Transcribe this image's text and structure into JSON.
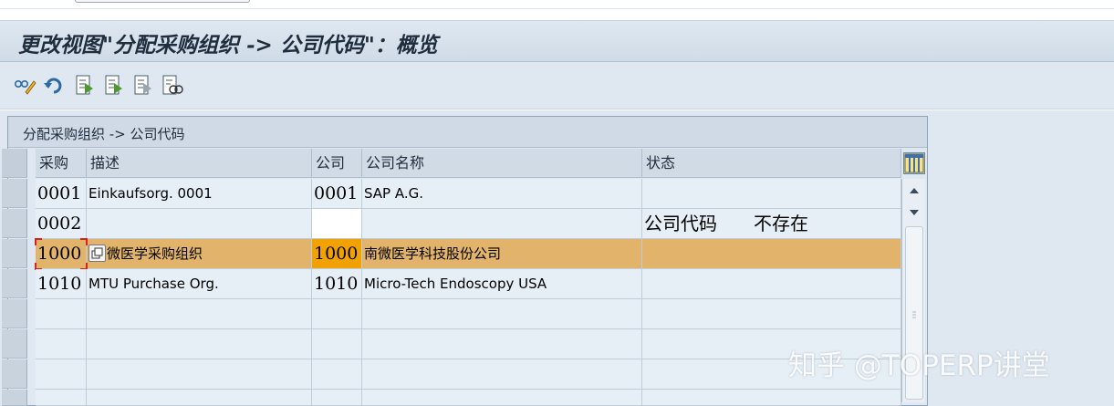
{
  "window": {
    "title": "更改视图\"分配采购组织 -> 公司代码\"：概览"
  },
  "toolbar": {
    "icons": [
      "display-change-icon",
      "undo-icon",
      "new-entries-icon",
      "copy-as-icon",
      "delete-icon",
      "select-all-icon"
    ]
  },
  "table": {
    "title": "分配采购组织 -> 公司代码",
    "columns": [
      "采购",
      "描述",
      "公司",
      "公司名称",
      "状态"
    ],
    "rows": [
      {
        "purch": "0001",
        "desc": "Einkaufsorg. 0001",
        "company": "0001",
        "company_name": "SAP A.G.",
        "status": ""
      },
      {
        "purch": "0002",
        "desc": "",
        "company": "",
        "company_name": "",
        "status": "公司代码　　不存在"
      },
      {
        "purch": "1000",
        "desc": "微医学采购组织",
        "company": "1000",
        "company_name": "南微医学科技股份公司",
        "status": ""
      },
      {
        "purch": "1010",
        "desc": "MTU Purchase Org.",
        "company": "1010",
        "company_name": "Micro-Tech Endoscopy USA",
        "status": ""
      }
    ]
  },
  "watermark": "知乎 @TOPERP讲堂",
  "colors": {
    "highlight_row": "#e2b46b",
    "focus_cell": "#f2a200",
    "frame_bg": "#dfe8f1"
  }
}
